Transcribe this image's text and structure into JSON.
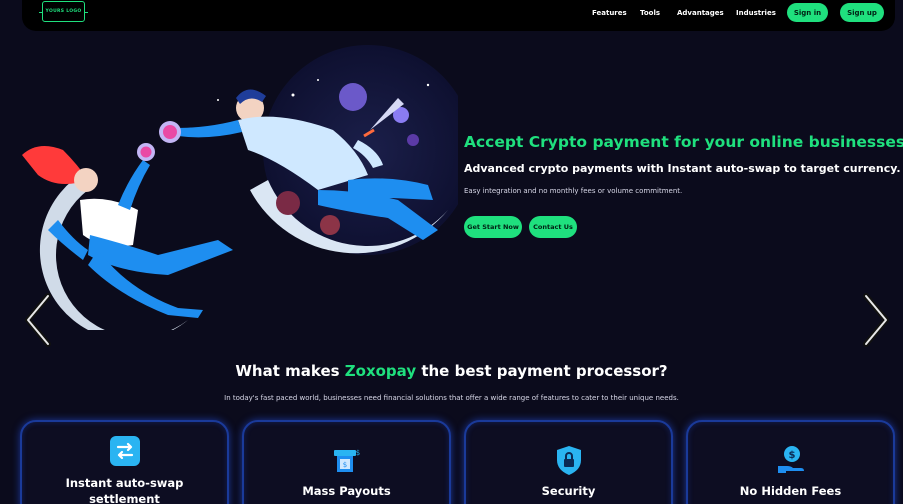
{
  "nav": {
    "logo_text": "YOURS LOGO",
    "links": [
      "Features",
      "Tools",
      "Advantages",
      "Industries"
    ],
    "signin_label": "Sign in",
    "signup_label": "Sign up"
  },
  "hero": {
    "title": "Accept Crypto payment for your online businesses",
    "subtitle": "Advanced crypto payments with Instant auto-swap to target currency.",
    "note": "Easy integration and no monthly fees or volume commitment.",
    "cta_primary": "Get Start Now",
    "cta_secondary": "Contact Us"
  },
  "section": {
    "title_prefix": "What makes ",
    "title_brand": "Zoxopay",
    "title_suffix": " the best payment processor?",
    "description": "In today's fast paced world, businesses need financial solutions that offer a wide range of features to cater to their unique needs."
  },
  "features": [
    {
      "title_line1": "Instant auto-swap",
      "title_line2": "settlement",
      "icon": "swap-arrows-icon"
    },
    {
      "title_line1": "Mass Payouts",
      "icon": "atm-cash-icon"
    },
    {
      "title_line1": "Security",
      "icon": "shield-lock-icon"
    },
    {
      "title_line1": "No Hidden Fees",
      "icon": "hand-coin-icon"
    }
  ],
  "colors": {
    "accent": "#1fe07e",
    "background": "#0b0b1c",
    "card_border": "#1a3a9a",
    "illustration_blue": "#1e8ef0"
  }
}
